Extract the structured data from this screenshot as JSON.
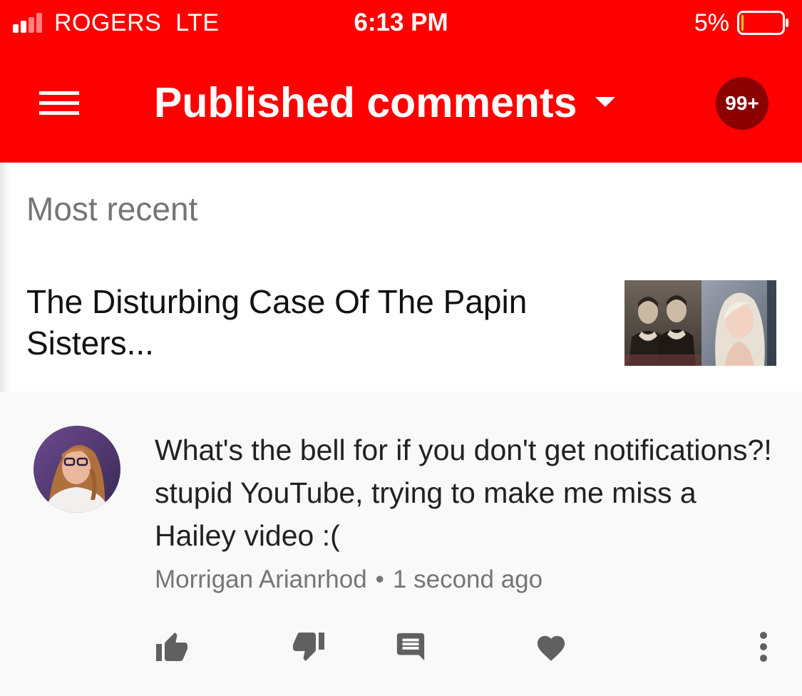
{
  "status_bar": {
    "carrier": "ROGERS",
    "network": "LTE",
    "time": "6:13 PM",
    "battery_percent": "5%",
    "battery_level": 0.05
  },
  "header": {
    "title": "Published comments",
    "notification_count": "99+",
    "icons": {
      "menu": "hamburger-menu-icon",
      "dropdown": "caret-down-icon"
    }
  },
  "section": {
    "heading": "Most recent"
  },
  "video": {
    "title": "The Disturbing Case Of The Papin Sisters..."
  },
  "comment": {
    "text": "What's the bell for if you don't get notifications?! stupid YouTube, trying to make me miss a Hailey video :(",
    "author": "Morrigan Arianrhod",
    "separator": "•",
    "time_ago": "1 second ago",
    "actions": [
      "thumb-up-icon",
      "thumb-down-icon",
      "reply-icon",
      "heart-icon",
      "more-vertical-icon"
    ]
  },
  "colors": {
    "brand_red": "#ff0000",
    "badge_dark_red": "#8b0000",
    "secondary_text": "#757575",
    "primary_text": "#212121",
    "icon_gray": "#606060",
    "battery_low": "#ffcc00"
  }
}
